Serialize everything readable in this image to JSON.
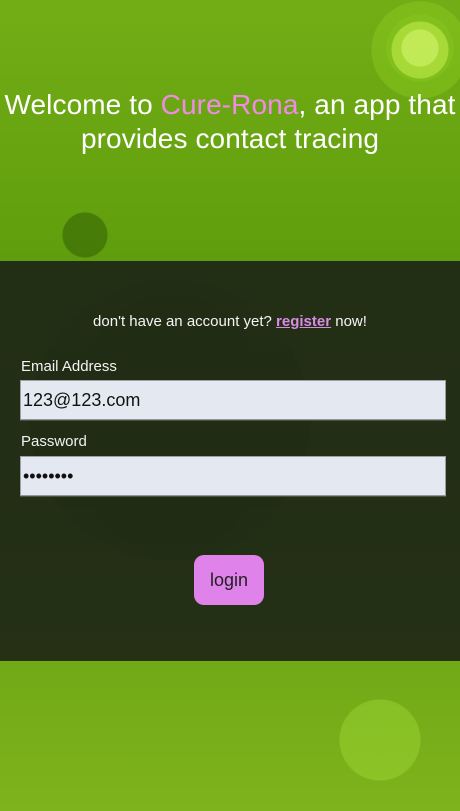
{
  "welcome": {
    "prefix": "Welcome to ",
    "brand": "Cure-Rona",
    "suffix": ", an app that provides contact tracing"
  },
  "login_form": {
    "register_prompt_before": "don't have an account yet? ",
    "register_link": "register",
    "register_prompt_after": " now!",
    "email_label": "Email Address",
    "email_value": "123@123.com",
    "password_label": "Password",
    "password_value": "12345678",
    "login_button": "login"
  },
  "colors": {
    "brand": "#f08be6",
    "panel": "#1e2616",
    "button": "#df82ea",
    "background_green": "#62a00e"
  }
}
